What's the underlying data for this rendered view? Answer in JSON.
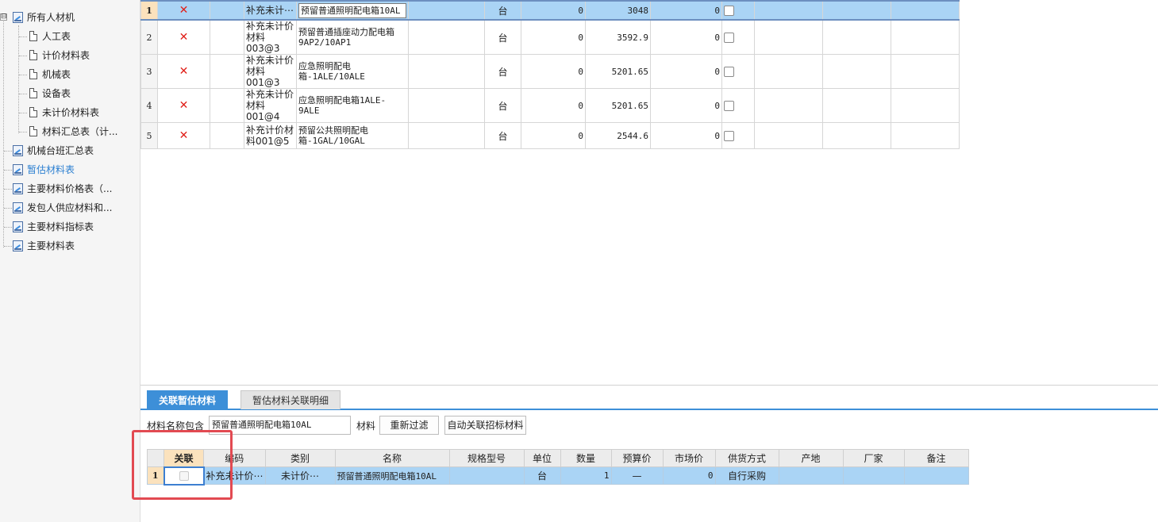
{
  "tree": {
    "root_label": "所有人材机",
    "expander_symbol": "⊟",
    "children": [
      {
        "label": "人工表"
      },
      {
        "label": "计价材料表"
      },
      {
        "label": "机械表"
      },
      {
        "label": "设备表"
      },
      {
        "label": "未计价材料表"
      },
      {
        "label": "材料汇总表（计..."
      }
    ],
    "reports": [
      {
        "label": "机械台班汇总表"
      },
      {
        "label": "暂估材料表"
      },
      {
        "label": "主要材料价格表（..."
      },
      {
        "label": "发包人供应材料和..."
      },
      {
        "label": "主要材料指标表"
      },
      {
        "label": "主要材料表"
      }
    ],
    "active_report": "暂估材料表"
  },
  "top_table": {
    "delete_mark": "✕",
    "rows": [
      {
        "num": "1",
        "code": "补充未计⋯",
        "name": "预留普通照明配电箱10AL",
        "unit": "台",
        "v1": "0",
        "v2": "3048",
        "v3": "0"
      },
      {
        "num": "2",
        "code": "补充未计价材料003@3",
        "name": "预留普通插座动力配电箱9AP2/10AP1",
        "unit": "台",
        "v1": "0",
        "v2": "3592.9",
        "v3": "0"
      },
      {
        "num": "3",
        "code": "补充未计价材料001@3",
        "name": "应急照明配电箱-1ALE/10ALE",
        "unit": "台",
        "v1": "0",
        "v2": "5201.65",
        "v3": "0"
      },
      {
        "num": "4",
        "code": "补充未计价材料001@4",
        "name": "应急照明配电箱1ALE-9ALE",
        "unit": "台",
        "v1": "0",
        "v2": "5201.65",
        "v3": "0"
      },
      {
        "num": "5",
        "code": "补充计价材料001@5",
        "name": "预留公共照明配电箱-1GAL/10GAL",
        "unit": "台",
        "v1": "0",
        "v2": "2544.6",
        "v3": "0"
      }
    ]
  },
  "bottom": {
    "tabs": [
      {
        "label": "关联暂估材料"
      },
      {
        "label": "暂估材料关联明细"
      }
    ],
    "filter": {
      "name_label": "材料名称包含",
      "name_value": "预留普通照明配电箱10AL",
      "type_label": "材料",
      "refilter_button": "重新过滤",
      "auto_link_button": "自动关联招标材料"
    },
    "columns": [
      "关联",
      "编码",
      "类别",
      "名称",
      "规格型号",
      "单位",
      "数量",
      "预算价",
      "市场价",
      "供货方式",
      "产地",
      "厂家",
      "备注"
    ],
    "row": {
      "num": "1",
      "code": "补充未计价⋯",
      "category": "未计价⋯",
      "name": "预留普通照明配电箱10AL",
      "spec": "",
      "unit": "台",
      "qty": "1",
      "budget_price": "—",
      "market_price": "0",
      "supply": "自行采购",
      "origin": "",
      "maker": "",
      "note": ""
    }
  },
  "colors": {
    "accent": "#3d8fd8",
    "selection": "#aad4f5",
    "delete": "#e0201a",
    "annotation": "#e24a52"
  }
}
